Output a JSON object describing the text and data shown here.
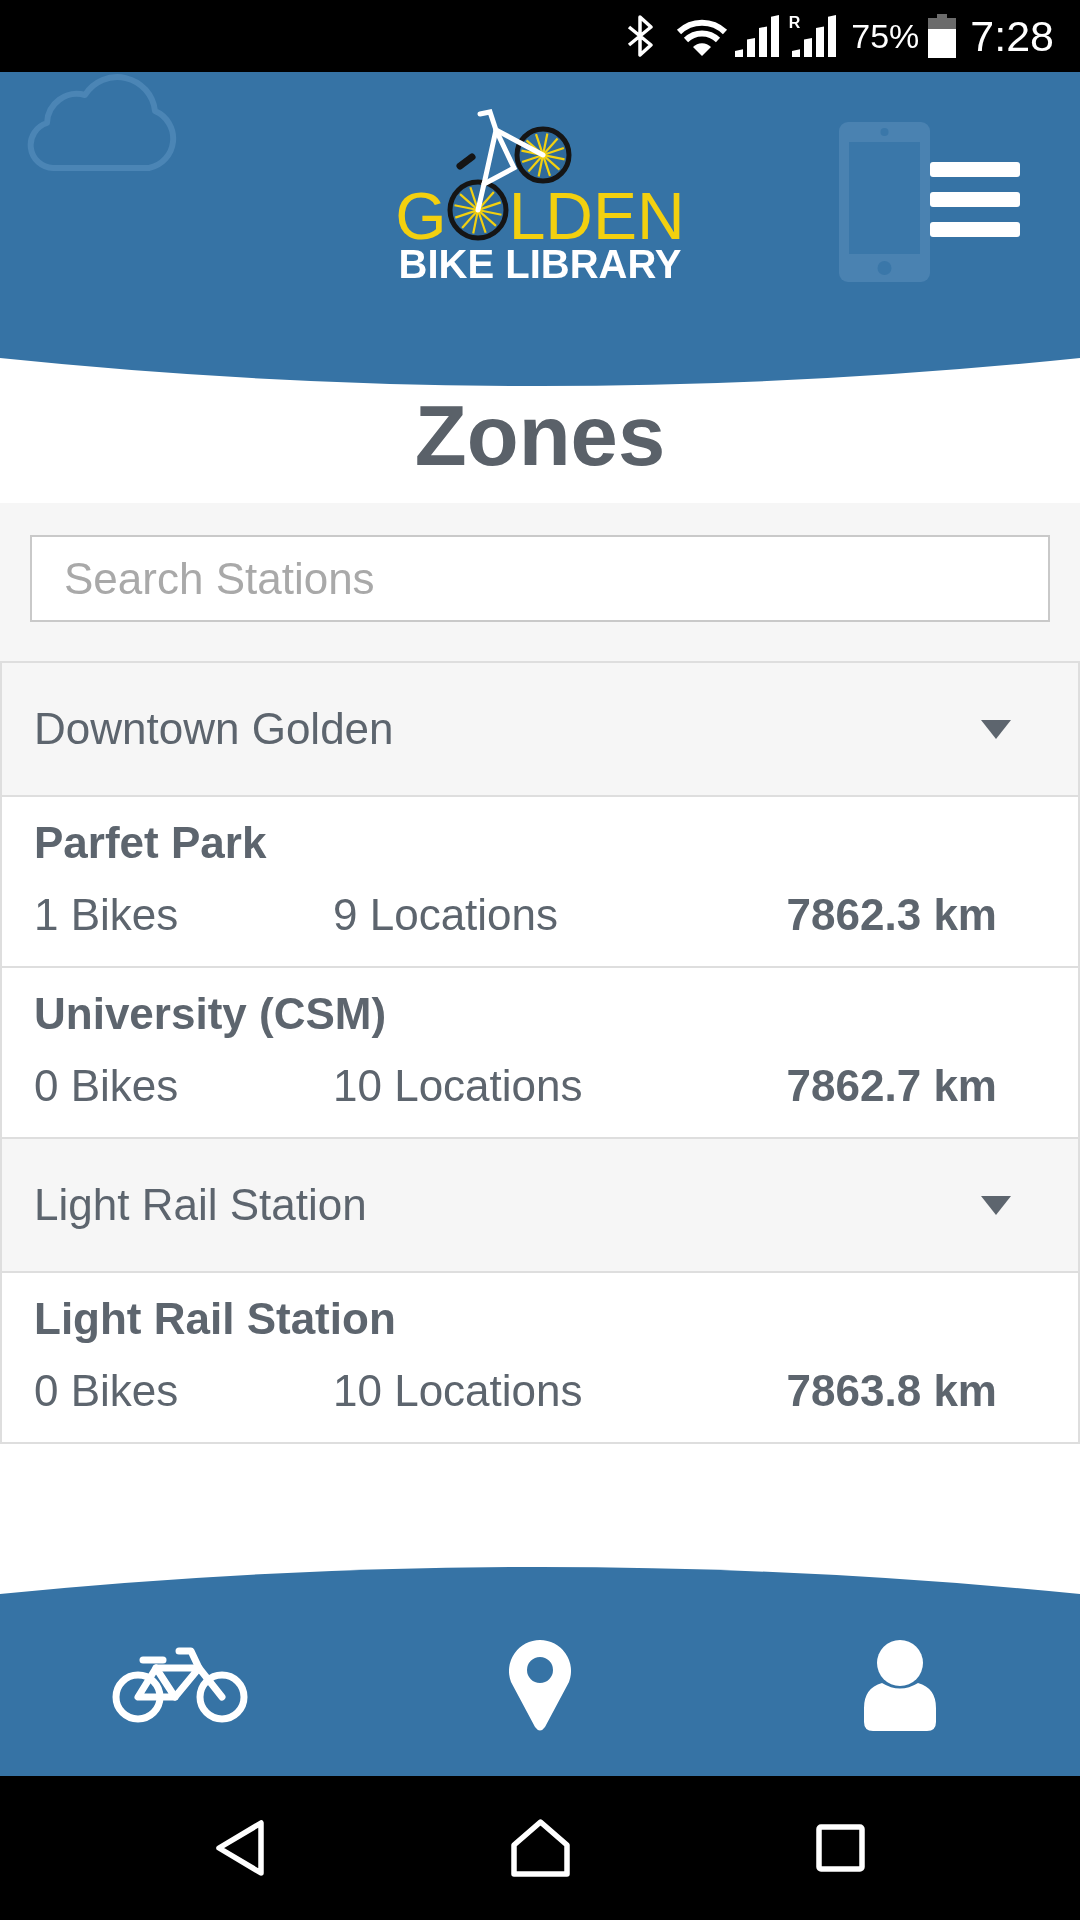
{
  "status_bar": {
    "roaming_label": "R",
    "battery": "75%",
    "time": "7:28"
  },
  "header": {
    "logo_title": [
      "G",
      "LDEN"
    ],
    "logo_subtitle": "BIKE LIBRARY"
  },
  "title": "Zones",
  "search": {
    "placeholder": "Search Stations"
  },
  "zones": [
    {
      "name": "Downtown Golden",
      "stations": [
        {
          "name": "Parfet Park",
          "bikes": "1 Bikes",
          "locations": "9 Locations",
          "distance": "7862.3 km"
        },
        {
          "name": "University (CSM)",
          "bikes": "0 Bikes",
          "locations": "10 Locations",
          "distance": "7862.7 km"
        }
      ]
    },
    {
      "name": "Light Rail Station",
      "stations": [
        {
          "name": "Light Rail Station",
          "bikes": "0 Bikes",
          "locations": "10 Locations",
          "distance": "7863.8 km"
        }
      ]
    }
  ],
  "bottom_nav": [
    {
      "kind": "bike"
    },
    {
      "kind": "pin"
    },
    {
      "kind": "person"
    }
  ],
  "system_nav": [
    {
      "kind": "back"
    },
    {
      "kind": "home"
    },
    {
      "kind": "recents"
    }
  ]
}
